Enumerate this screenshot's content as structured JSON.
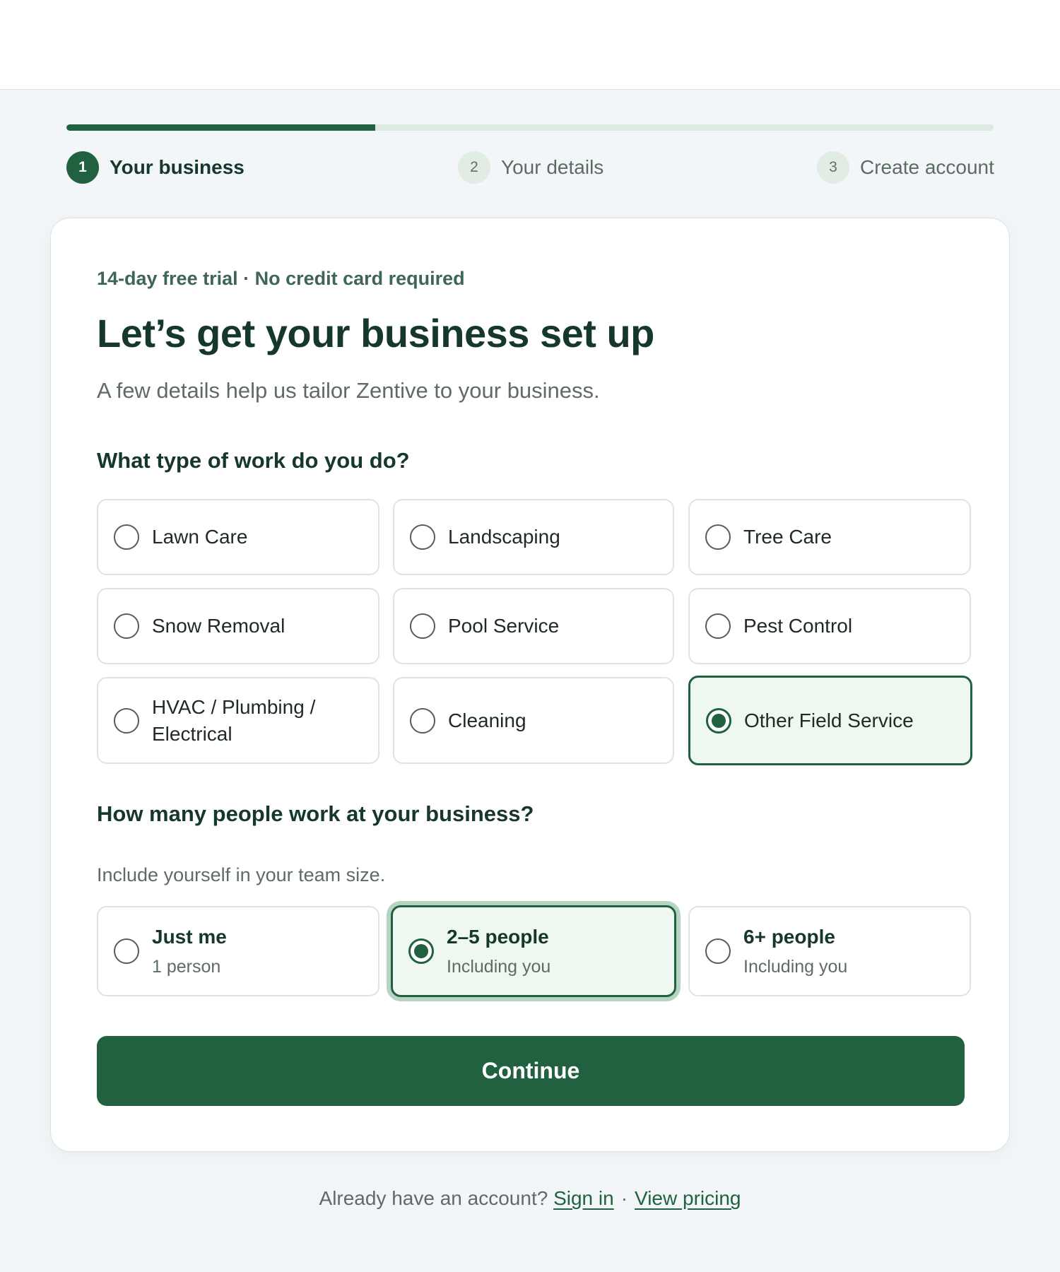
{
  "progress": {
    "fraction": 0.333
  },
  "steps": [
    {
      "number": "1",
      "label": "Your business",
      "active": true
    },
    {
      "number": "2",
      "label": "Your details",
      "active": false
    },
    {
      "number": "3",
      "label": "Create account",
      "active": false
    }
  ],
  "card": {
    "eyebrow": "14-day free trial · No credit card required",
    "title": "Let’s get your business set up",
    "subtitle": "A few details help us tailor Zentive to your business."
  },
  "work_type": {
    "question": "What type of work do you do?",
    "selected": "Other Field Service",
    "options": [
      {
        "label": "Lawn Care"
      },
      {
        "label": "Landscaping"
      },
      {
        "label": "Tree Care"
      },
      {
        "label": "Snow Removal"
      },
      {
        "label": "Pool Service"
      },
      {
        "label": "Pest Control"
      },
      {
        "label": "HVAC / Plumbing / Electrical"
      },
      {
        "label": "Cleaning"
      },
      {
        "label": "Other Field Service"
      }
    ]
  },
  "team_size": {
    "question": "How many people work at your business?",
    "hint": "Include yourself in your team size.",
    "selected": "2–5 people",
    "options": [
      {
        "label": "Just me",
        "sub": "1 person"
      },
      {
        "label": "2–5 people",
        "sub": "Including you"
      },
      {
        "label": "6+ people",
        "sub": "Including you"
      }
    ]
  },
  "actions": {
    "continue_label": "Continue"
  },
  "footer": {
    "prompt": "Already have an account?",
    "sign_in": "Sign in",
    "separator": "·",
    "pricing": "View pricing"
  },
  "colors": {
    "accent": "#22613f",
    "selected_bg": "#eef7f0",
    "page_bg": "#f2f6f8"
  }
}
